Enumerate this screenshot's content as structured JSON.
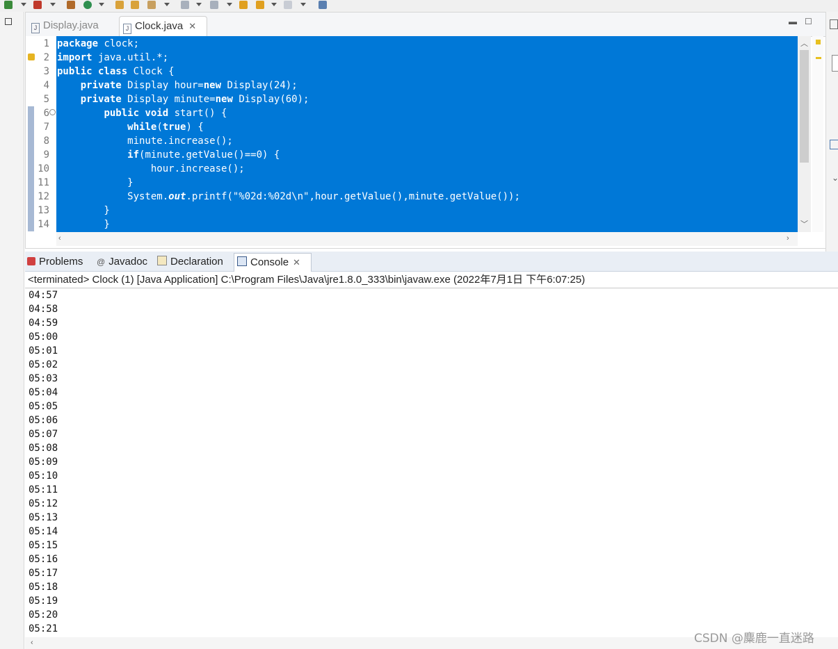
{
  "editor": {
    "tabs": [
      {
        "label": "Display.java"
      },
      {
        "label": "Clock.java"
      }
    ],
    "lines": [
      {
        "n": "1",
        "parts": [
          {
            "t": "package",
            "k": 1
          },
          {
            "t": " clock;"
          }
        ]
      },
      {
        "n": "2",
        "parts": [
          {
            "t": "import",
            "k": 1
          },
          {
            "t": " java.util.*;"
          }
        ]
      },
      {
        "n": "3",
        "parts": [
          {
            "t": "public class",
            "k": 1
          },
          {
            "t": " Clock {"
          }
        ]
      },
      {
        "n": "4",
        "parts": [
          {
            "t": "    "
          },
          {
            "t": "private",
            "k": 1
          },
          {
            "t": " Display hour="
          },
          {
            "t": "new",
            "k": 1
          },
          {
            "t": " Display(24);"
          }
        ]
      },
      {
        "n": "5",
        "parts": [
          {
            "t": "    "
          },
          {
            "t": "private",
            "k": 1
          },
          {
            "t": " Display minute="
          },
          {
            "t": "new",
            "k": 1
          },
          {
            "t": " Display(60);"
          }
        ]
      },
      {
        "n": "6",
        "parts": [
          {
            "t": "        "
          },
          {
            "t": "public void",
            "k": 1
          },
          {
            "t": " start() {"
          }
        ]
      },
      {
        "n": "7",
        "parts": [
          {
            "t": "            "
          },
          {
            "t": "while",
            "k": 1
          },
          {
            "t": "("
          },
          {
            "t": "true",
            "k": 1
          },
          {
            "t": ") {"
          }
        ]
      },
      {
        "n": "8",
        "parts": [
          {
            "t": "            minute.increase();"
          }
        ]
      },
      {
        "n": "9",
        "parts": [
          {
            "t": "            "
          },
          {
            "t": "if",
            "k": 1
          },
          {
            "t": "(minute.getValue()==0) {"
          }
        ]
      },
      {
        "n": "10",
        "parts": [
          {
            "t": "                hour.increase();"
          }
        ]
      },
      {
        "n": "11",
        "parts": [
          {
            "t": "            }"
          }
        ]
      },
      {
        "n": "12",
        "parts": [
          {
            "t": "            System."
          },
          {
            "t": "out",
            "k": 2
          },
          {
            "t": ".printf(\"%02d:%02d\\n\",hour.getValue(),minute.getValue());"
          }
        ]
      },
      {
        "n": "13",
        "parts": [
          {
            "t": "        }"
          }
        ]
      },
      {
        "n": "14",
        "parts": [
          {
            "t": "        }"
          }
        ]
      }
    ]
  },
  "console": {
    "tabs": [
      {
        "label": "Problems"
      },
      {
        "label": "Javadoc"
      },
      {
        "label": "Declaration"
      },
      {
        "label": "Console"
      }
    ],
    "status": "<terminated> Clock (1) [Java Application] C:\\Program Files\\Java\\jre1.8.0_333\\bin\\javaw.exe (2022年7月1日 下午6:07:25)",
    "output": [
      "04:57",
      "04:58",
      "04:59",
      "05:00",
      "05:01",
      "05:02",
      "05:03",
      "05:04",
      "05:05",
      "05:06",
      "05:07",
      "05:08",
      "05:09",
      "05:10",
      "05:11",
      "05:12",
      "05:13",
      "05:14",
      "05:15",
      "05:16",
      "05:17",
      "05:18",
      "05:19",
      "05:20",
      "05:21"
    ]
  },
  "watermark": "CSDN @麋鹿一直迷路",
  "colors": {
    "selection": "#0078d7",
    "console_tab_bar": "#e9eef5"
  }
}
